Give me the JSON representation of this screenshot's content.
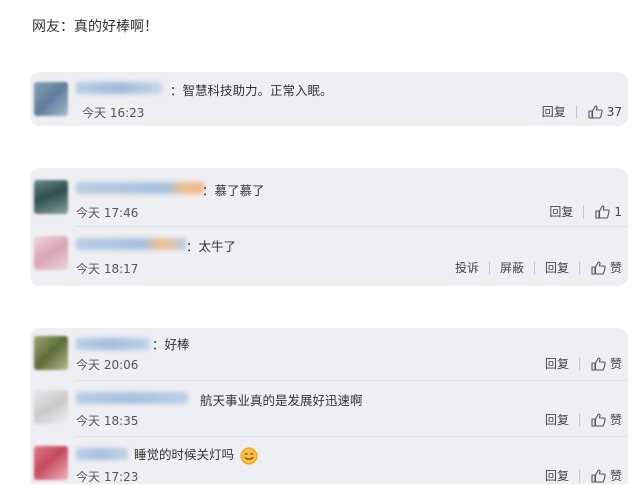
{
  "heading": "网友：真的好棒啊！",
  "actions": {
    "reply": "回复",
    "report": "投诉",
    "block": "屏蔽",
    "like_text": "赞"
  },
  "comments": [
    {
      "text": "：智慧科技助力。正常入眠。",
      "time": "今天 16:23",
      "likes": "37"
    },
    {
      "text": "：慕了慕了",
      "time": "今天 17:46",
      "likes": "1"
    },
    {
      "text": "：太牛了",
      "time": "今天 18:17",
      "likes": "赞"
    },
    {
      "text": "：好棒",
      "time": "今天 20:06",
      "likes": "赞"
    },
    {
      "text": "航天事业真的是发展好迅速啊",
      "time": "今天 18:35",
      "likes": "赞"
    },
    {
      "text": "睡觉的时候关灯吗",
      "time": "今天 17:23",
      "likes": "赞"
    }
  ],
  "colors": {
    "card": "#eeeff3",
    "text": "#333333",
    "muted": "#555555"
  }
}
